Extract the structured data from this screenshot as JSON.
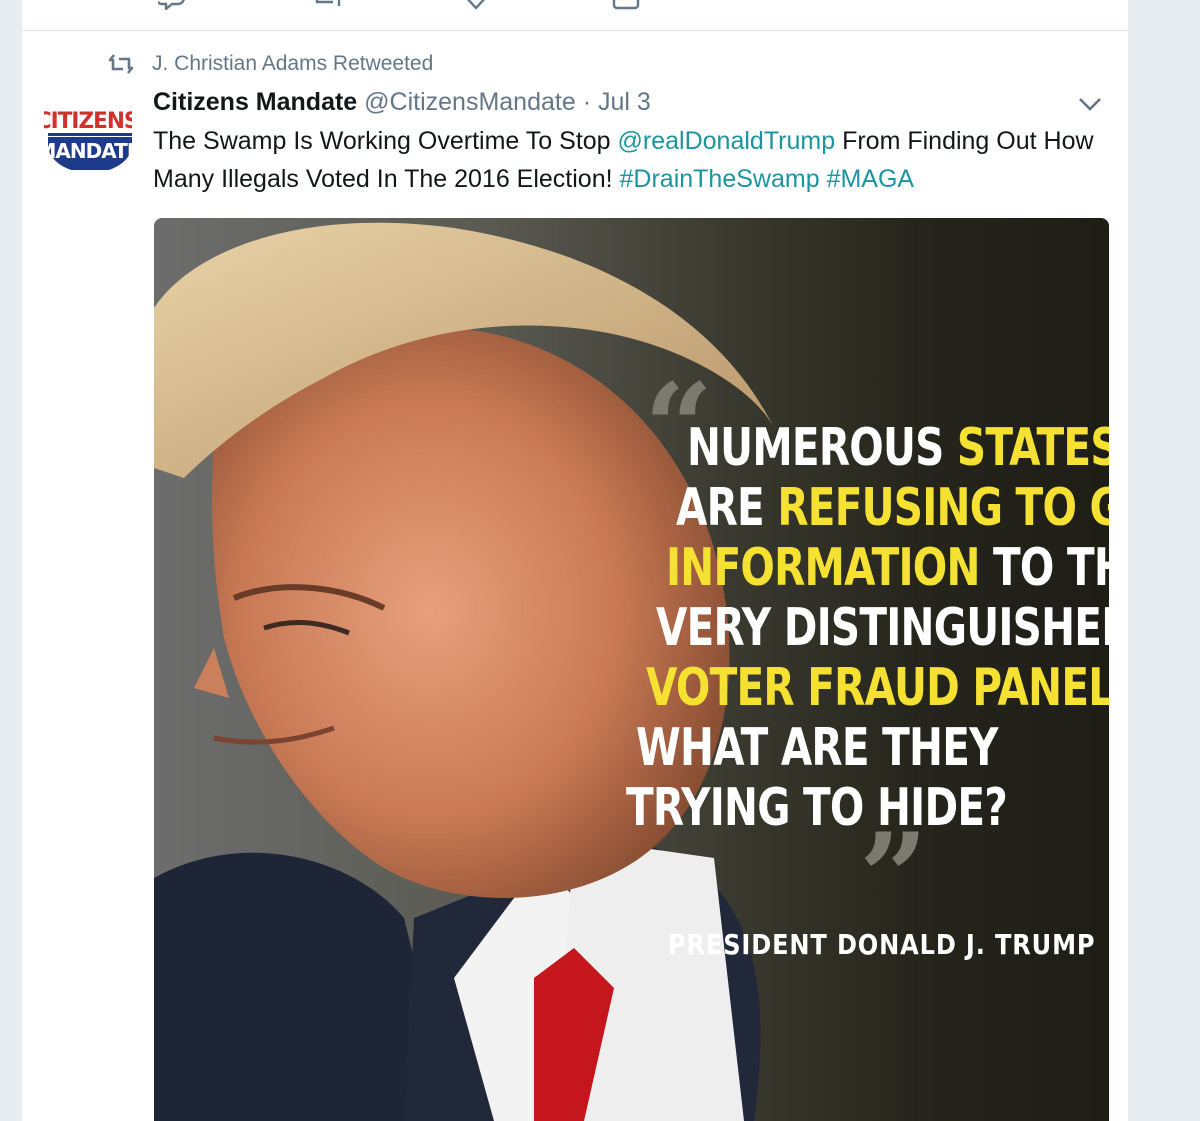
{
  "retweet": {
    "label": "J. Christian Adams Retweeted"
  },
  "tweet": {
    "author_name": "Citizens Mandate",
    "author_handle": "@CitizensMandate",
    "separator": "·",
    "date": "Jul 3",
    "avatar_lines": [
      "CITIZENS",
      "MANDATE"
    ],
    "text_parts": {
      "t1": "The Swamp Is Working Overtime To Stop ",
      "mention": "@realDonaldTrump",
      "t2": " From Finding Out How Many Illegals Voted In The 2016 Election! ",
      "hashtag1": "#DrainTheSwamp",
      "space": " ",
      "hashtag2": "#MAGA"
    }
  },
  "media": {
    "quote_lines": [
      {
        "a": "NUMEROUS ",
        "b": "STATES",
        "c": ""
      },
      {
        "a": "ARE ",
        "b": "REFUSING TO GIVE",
        "c": ""
      },
      {
        "a": "",
        "b": "INFORMATION",
        "c": " TO THE"
      },
      {
        "a": "VERY DISTINGUISHED",
        "b": "",
        "c": ""
      },
      {
        "a": "",
        "b": "VOTER FRAUD PANEL",
        "c": "."
      },
      {
        "a": "WHAT ARE THEY",
        "b": "",
        "c": ""
      },
      {
        "a": "TRYING TO HIDE?",
        "b": "",
        "c": ""
      }
    ],
    "open_quote": "“",
    "close_quote": "”",
    "attribution": "PRESIDENT DONALD J. TRUMP"
  },
  "colors": {
    "link": "#1b95a0",
    "highlight": "#f5e132",
    "muted": "#657786",
    "avatar_red": "#d0312d",
    "avatar_blue": "#1e3a8a"
  },
  "icons": [
    "retweet-icon",
    "chevron-down-icon",
    "reply-icon",
    "like-icon",
    "dm-icon"
  ]
}
